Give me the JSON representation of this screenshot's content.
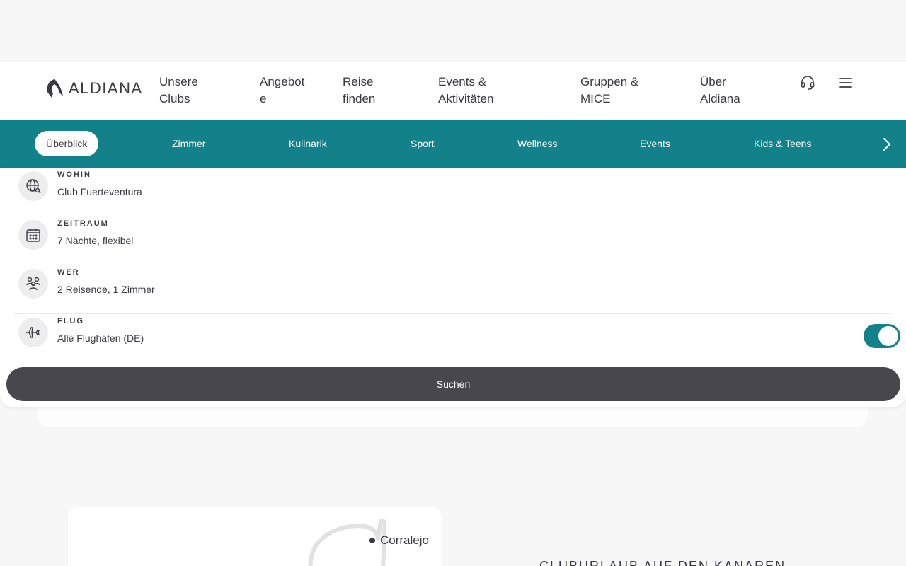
{
  "header": {
    "logo_text": "ALDIANA",
    "nav": [
      {
        "label": "Unsere\nClubs"
      },
      {
        "label": "Angebot\ne"
      },
      {
        "label": "Reise\nfinden"
      },
      {
        "label": "Events &\nAktivitäten"
      },
      {
        "label": "Gruppen &\nMICE"
      },
      {
        "label": "Über\nAldiana"
      }
    ],
    "icons": [
      "headset-icon",
      "menu-icon"
    ]
  },
  "tabs": {
    "items": [
      {
        "label": "Überblick",
        "active": true
      },
      {
        "label": "Zimmer"
      },
      {
        "label": "Kulinarik"
      },
      {
        "label": "Sport"
      },
      {
        "label": "Wellness"
      },
      {
        "label": "Events"
      },
      {
        "label": "Kids & Teens"
      }
    ],
    "next_icon": "chevron-right-icon"
  },
  "search": {
    "rows": [
      {
        "label": "WOHIN",
        "value": "Club Fuerteventura",
        "icon": "globe-search-icon"
      },
      {
        "label": "ZEITRAUM",
        "value": "7 Nächte, flexibel",
        "icon": "calendar-icon"
      },
      {
        "label": "WER",
        "value": "2 Reisende, 1 Zimmer",
        "icon": "people-icon"
      },
      {
        "label": "FLUG",
        "value": "Alle Flughäfen (DE)",
        "icon": "airplane-icon",
        "toggle_on": true
      }
    ],
    "submit_label": "Suchen"
  },
  "map": {
    "place_label": "Corralejo"
  },
  "section": {
    "heading": "CLUBURLAUB AUF DEN KANAREN"
  },
  "colors": {
    "accent": "#12818a",
    "button": "#48474e",
    "text": "#3a3a40"
  }
}
